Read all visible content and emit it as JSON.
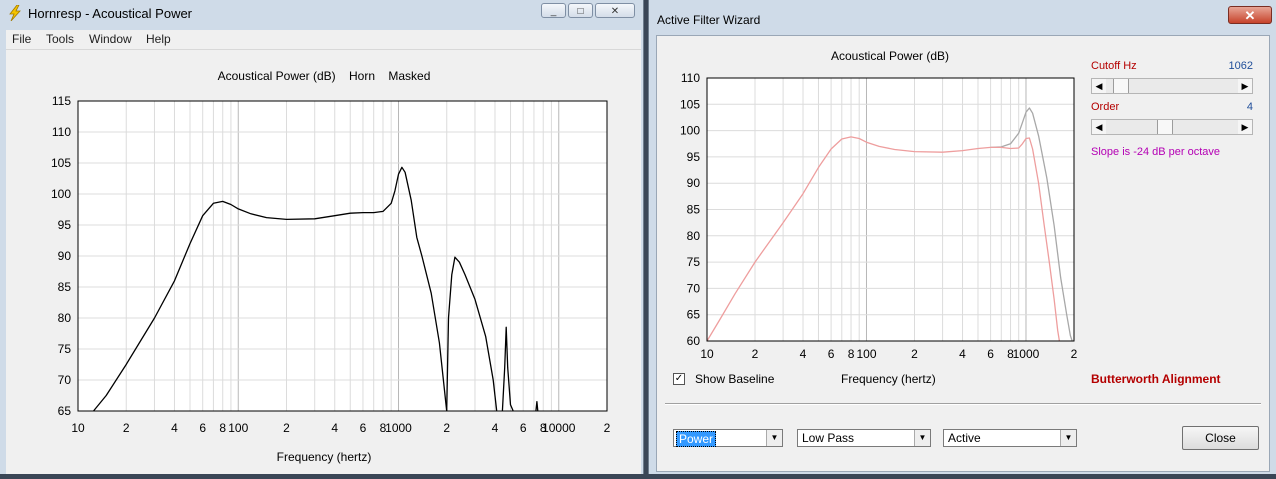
{
  "left_window": {
    "title": "Hornresp - Acoustical Power",
    "title_buttons": [
      "_",
      "□",
      "✕"
    ],
    "menu": [
      "File",
      "Tools",
      "Window",
      "Help"
    ],
    "chart_data": {
      "type": "line",
      "title": "Acoustical Power (dB)    Horn    Masked",
      "xlabel": "Frequency (hertz)",
      "ylabel": "",
      "xscale": "log",
      "xlim": [
        10,
        20000
      ],
      "ylim": [
        65,
        115
      ],
      "yticks": [
        115,
        110,
        105,
        100,
        95,
        90,
        85,
        80,
        75,
        70,
        65
      ],
      "xtick_labels": [
        {
          "f": 10,
          "label": "10"
        },
        {
          "f": 20,
          "label": "2"
        },
        {
          "f": 40,
          "label": "4"
        },
        {
          "f": 60,
          "label": "6"
        },
        {
          "f": 80,
          "label": "8"
        },
        {
          "f": 100,
          "label": "100"
        },
        {
          "f": 200,
          "label": "2"
        },
        {
          "f": 400,
          "label": "4"
        },
        {
          "f": 600,
          "label": "6"
        },
        {
          "f": 800,
          "label": "8"
        },
        {
          "f": 1000,
          "label": "1000"
        },
        {
          "f": 2000,
          "label": "2"
        },
        {
          "f": 4000,
          "label": "4"
        },
        {
          "f": 6000,
          "label": "6"
        },
        {
          "f": 8000,
          "label": "8"
        },
        {
          "f": 10000,
          "label": "10000"
        },
        {
          "f": 20000,
          "label": "2"
        }
      ],
      "grid": true,
      "series": [
        {
          "color": "#000000",
          "segments": [
            [
              [
                12.5,
                65
              ],
              [
                15,
                67.5
              ],
              [
                20,
                72.5
              ],
              [
                30,
                80
              ],
              [
                40,
                86
              ],
              [
                50,
                92
              ],
              [
                60,
                96.5
              ],
              [
                70,
                98.5
              ],
              [
                80,
                98.8
              ],
              [
                90,
                98.3
              ],
              [
                100,
                97.6
              ],
              [
                120,
                96.8
              ],
              [
                150,
                96.2
              ],
              [
                200,
                95.9
              ],
              [
                300,
                96.0
              ],
              [
                400,
                96.5
              ],
              [
                500,
                96.9
              ],
              [
                600,
                97.0
              ],
              [
                700,
                97.0
              ],
              [
                800,
                97.2
              ],
              [
                900,
                98.5
              ],
              [
                950,
                100.5
              ],
              [
                1000,
                103.2
              ],
              [
                1050,
                104.3
              ],
              [
                1100,
                103.5
              ],
              [
                1200,
                99
              ],
              [
                1300,
                93
              ],
              [
                1400,
                90
              ],
              [
                1600,
                84
              ],
              [
                1800,
                76
              ],
              [
                2000,
                65
              ]
            ],
            [
              [
                2000,
                65
              ],
              [
                2050,
                80
              ],
              [
                2150,
                87
              ],
              [
                2250,
                89.8
              ],
              [
                2400,
                89
              ],
              [
                2600,
                87
              ],
              [
                3000,
                83
              ],
              [
                3500,
                77
              ],
              [
                3900,
                70
              ],
              [
                4100,
                65
              ]
            ],
            [
              [
                4450,
                65
              ],
              [
                4600,
                72
              ],
              [
                4700,
                78.5
              ],
              [
                4800,
                72
              ],
              [
                5000,
                66
              ],
              [
                5200,
                65
              ]
            ],
            [
              [
                7200,
                65
              ],
              [
                7300,
                66.5
              ],
              [
                7400,
                65
              ]
            ]
          ]
        }
      ]
    }
  },
  "right_window": {
    "title": "Active Filter Wizard",
    "close_glyph": "✕",
    "chart_data": {
      "type": "line",
      "title": "Acoustical Power (dB)",
      "xlabel": "Frequency (hertz)",
      "ylabel": "",
      "xscale": "log",
      "xlim": [
        10,
        2000
      ],
      "ylim": [
        60,
        110
      ],
      "yticks": [
        110,
        105,
        100,
        95,
        90,
        85,
        80,
        75,
        70,
        65,
        60
      ],
      "xtick_labels": [
        {
          "f": 10,
          "label": "10"
        },
        {
          "f": 20,
          "label": "2"
        },
        {
          "f": 40,
          "label": "4"
        },
        {
          "f": 60,
          "label": "6"
        },
        {
          "f": 80,
          "label": "8"
        },
        {
          "f": 100,
          "label": "100"
        },
        {
          "f": 200,
          "label": "2"
        },
        {
          "f": 400,
          "label": "4"
        },
        {
          "f": 600,
          "label": "6"
        },
        {
          "f": 800,
          "label": "8"
        },
        {
          "f": 1000,
          "label": "1000"
        },
        {
          "f": 2000,
          "label": "2"
        }
      ],
      "grid": true,
      "series": [
        {
          "color": "#a8a8a8",
          "segments": [
            [
              [
                600,
                96.8
              ],
              [
                700,
                96.9
              ],
              [
                800,
                97.5
              ],
              [
                900,
                99.5
              ],
              [
                950,
                101.5
              ],
              [
                1000,
                103.5
              ],
              [
                1050,
                104.3
              ],
              [
                1100,
                103.3
              ],
              [
                1200,
                99
              ],
              [
                1350,
                91
              ],
              [
                1500,
                82
              ],
              [
                1650,
                72
              ],
              [
                1800,
                65
              ],
              [
                1900,
                61
              ],
              [
                1950,
                60
              ]
            ]
          ]
        },
        {
          "color": "#ee9e9e",
          "segments": [
            [
              [
                10,
                60
              ],
              [
                12,
                64
              ],
              [
                15,
                69
              ],
              [
                20,
                75
              ],
              [
                30,
                82.5
              ],
              [
                40,
                88
              ],
              [
                50,
                93
              ],
              [
                60,
                96.5
              ],
              [
                70,
                98.4
              ],
              [
                80,
                98.8
              ],
              [
                90,
                98.5
              ],
              [
                100,
                97.8
              ],
              [
                120,
                97.0
              ],
              [
                150,
                96.4
              ],
              [
                200,
                96.0
              ],
              [
                300,
                95.9
              ],
              [
                400,
                96.2
              ],
              [
                500,
                96.6
              ],
              [
                600,
                96.8
              ],
              [
                700,
                96.8
              ],
              [
                800,
                96.6
              ],
              [
                900,
                96.7
              ],
              [
                950,
                97.5
              ],
              [
                1000,
                98.5
              ],
              [
                1050,
                98.6
              ],
              [
                1100,
                96.5
              ],
              [
                1200,
                90
              ],
              [
                1300,
                82
              ],
              [
                1400,
                75
              ],
              [
                1500,
                68
              ],
              [
                1580,
                62
              ],
              [
                1620,
                60
              ]
            ]
          ]
        }
      ]
    },
    "cutoff": {
      "label": "Cutoff  Hz",
      "value": "1062",
      "position": 0.06
    },
    "order": {
      "label": "Order",
      "value": "4",
      "position": 0.44
    },
    "slope_text": "Slope is -24 dB per octave",
    "show_baseline": {
      "label": "Show Baseline",
      "checked": true
    },
    "alignment": "Butterworth Alignment",
    "combos": {
      "measure": "Power",
      "filter_type": "Low Pass",
      "filter_mode": "Active"
    },
    "close_label": "Close",
    "colors": {
      "red_label": "#b40000",
      "blue_value": "#1f4e9a",
      "magenta": "#b400b4"
    }
  }
}
